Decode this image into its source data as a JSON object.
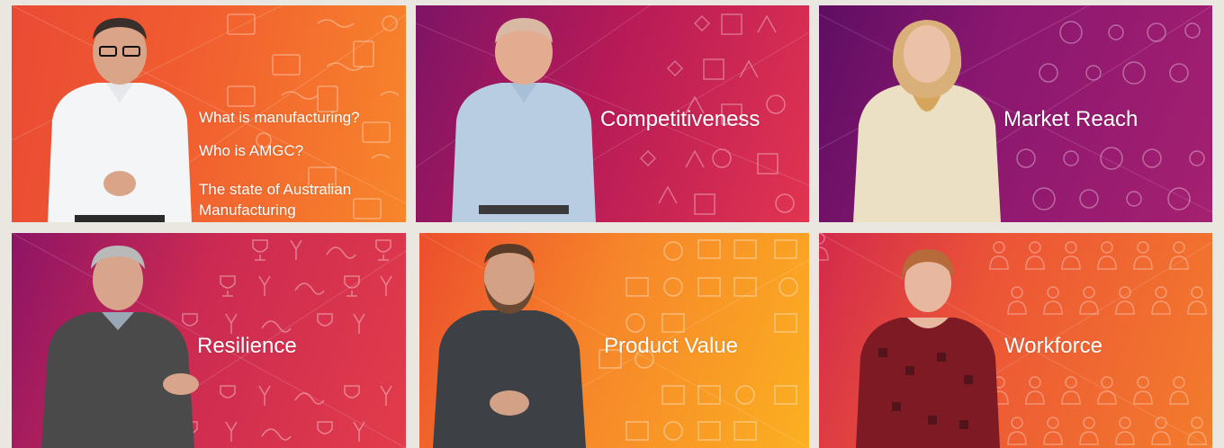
{
  "tiles": [
    {
      "id": "intro",
      "lines": [
        "What is manufacturing?",
        "Who is AMGC?",
        "The state of Australian",
        "Manufacturing"
      ],
      "icons": "handshake-gear-checklist-truck-icons",
      "presenter": "man-white-shirt-glasses"
    },
    {
      "id": "competitiveness",
      "title": "Competitiveness",
      "icons": "runner-box-lightbulb-mountain-icons",
      "presenter": "man-blue-shirt"
    },
    {
      "id": "market-reach",
      "title": "Market Reach",
      "icons": "globe-network-handshake-icons",
      "presenter": "woman-cream-jacket-scarf"
    },
    {
      "id": "resilience",
      "title": "Resilience",
      "icons": "trophy-curve-icons",
      "presenter": "man-grey-sweater"
    },
    {
      "id": "product-value",
      "title": "Product Value",
      "icons": "blueprint-magnifier-box-icons",
      "presenter": "man-dark-shirt-beard"
    },
    {
      "id": "workforce",
      "title": "Workforce",
      "icons": "worker-hardhat-icons",
      "presenter": "woman-red-patterned-top"
    }
  ]
}
